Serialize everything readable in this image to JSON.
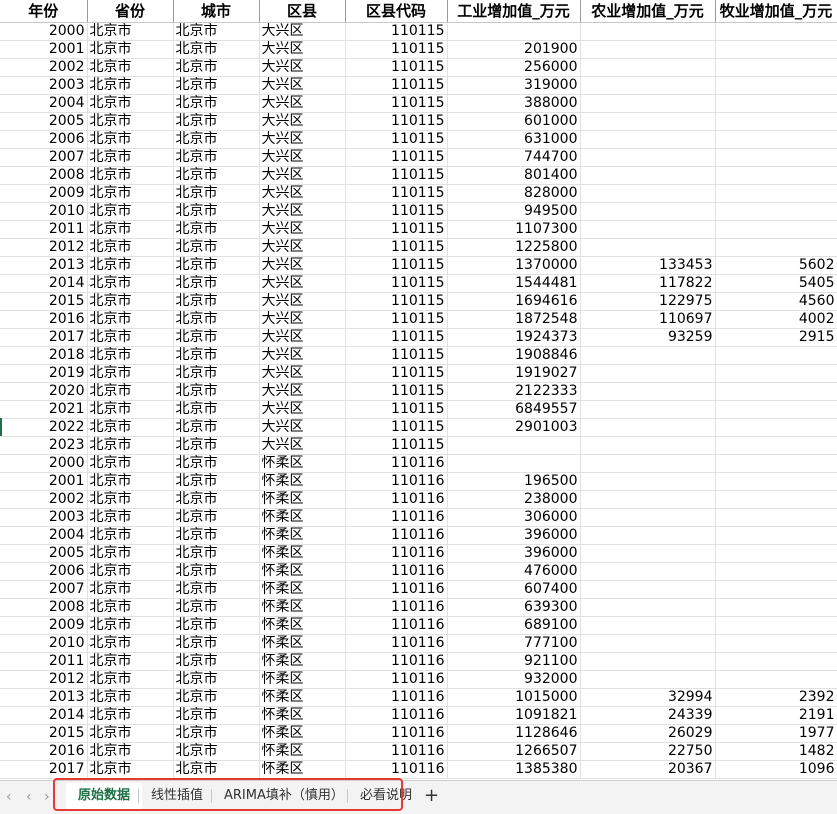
{
  "headers": [
    "年份",
    "省份",
    "城市",
    "区县",
    "区县代码",
    "工业增加值_万元",
    "农业增加值_万元",
    "牧业增加值_万元"
  ],
  "rows": [
    [
      "2000",
      "北京市",
      "北京市",
      "大兴区",
      "110115",
      "",
      "",
      ""
    ],
    [
      "2001",
      "北京市",
      "北京市",
      "大兴区",
      "110115",
      "201900",
      "",
      ""
    ],
    [
      "2002",
      "北京市",
      "北京市",
      "大兴区",
      "110115",
      "256000",
      "",
      ""
    ],
    [
      "2003",
      "北京市",
      "北京市",
      "大兴区",
      "110115",
      "319000",
      "",
      ""
    ],
    [
      "2004",
      "北京市",
      "北京市",
      "大兴区",
      "110115",
      "388000",
      "",
      ""
    ],
    [
      "2005",
      "北京市",
      "北京市",
      "大兴区",
      "110115",
      "601000",
      "",
      ""
    ],
    [
      "2006",
      "北京市",
      "北京市",
      "大兴区",
      "110115",
      "631000",
      "",
      ""
    ],
    [
      "2007",
      "北京市",
      "北京市",
      "大兴区",
      "110115",
      "744700",
      "",
      ""
    ],
    [
      "2008",
      "北京市",
      "北京市",
      "大兴区",
      "110115",
      "801400",
      "",
      ""
    ],
    [
      "2009",
      "北京市",
      "北京市",
      "大兴区",
      "110115",
      "828000",
      "",
      ""
    ],
    [
      "2010",
      "北京市",
      "北京市",
      "大兴区",
      "110115",
      "949500",
      "",
      ""
    ],
    [
      "2011",
      "北京市",
      "北京市",
      "大兴区",
      "110115",
      "1107300",
      "",
      ""
    ],
    [
      "2012",
      "北京市",
      "北京市",
      "大兴区",
      "110115",
      "1225800",
      "",
      ""
    ],
    [
      "2013",
      "北京市",
      "北京市",
      "大兴区",
      "110115",
      "1370000",
      "133453",
      "5602"
    ],
    [
      "2014",
      "北京市",
      "北京市",
      "大兴区",
      "110115",
      "1544481",
      "117822",
      "5405"
    ],
    [
      "2015",
      "北京市",
      "北京市",
      "大兴区",
      "110115",
      "1694616",
      "122975",
      "4560"
    ],
    [
      "2016",
      "北京市",
      "北京市",
      "大兴区",
      "110115",
      "1872548",
      "110697",
      "4002"
    ],
    [
      "2017",
      "北京市",
      "北京市",
      "大兴区",
      "110115",
      "1924373",
      "93259",
      "2915"
    ],
    [
      "2018",
      "北京市",
      "北京市",
      "大兴区",
      "110115",
      "1908846",
      "",
      ""
    ],
    [
      "2019",
      "北京市",
      "北京市",
      "大兴区",
      "110115",
      "1919027",
      "",
      ""
    ],
    [
      "2020",
      "北京市",
      "北京市",
      "大兴区",
      "110115",
      "2122333",
      "",
      ""
    ],
    [
      "2021",
      "北京市",
      "北京市",
      "大兴区",
      "110115",
      "6849557",
      "",
      ""
    ],
    [
      "2022",
      "北京市",
      "北京市",
      "大兴区",
      "110115",
      "2901003",
      "",
      ""
    ],
    [
      "2023",
      "北京市",
      "北京市",
      "大兴区",
      "110115",
      "",
      "",
      ""
    ],
    [
      "2000",
      "北京市",
      "北京市",
      "怀柔区",
      "110116",
      "",
      "",
      ""
    ],
    [
      "2001",
      "北京市",
      "北京市",
      "怀柔区",
      "110116",
      "196500",
      "",
      ""
    ],
    [
      "2002",
      "北京市",
      "北京市",
      "怀柔区",
      "110116",
      "238000",
      "",
      ""
    ],
    [
      "2003",
      "北京市",
      "北京市",
      "怀柔区",
      "110116",
      "306000",
      "",
      ""
    ],
    [
      "2004",
      "北京市",
      "北京市",
      "怀柔区",
      "110116",
      "396000",
      "",
      ""
    ],
    [
      "2005",
      "北京市",
      "北京市",
      "怀柔区",
      "110116",
      "396000",
      "",
      ""
    ],
    [
      "2006",
      "北京市",
      "北京市",
      "怀柔区",
      "110116",
      "476000",
      "",
      ""
    ],
    [
      "2007",
      "北京市",
      "北京市",
      "怀柔区",
      "110116",
      "607400",
      "",
      ""
    ],
    [
      "2008",
      "北京市",
      "北京市",
      "怀柔区",
      "110116",
      "639300",
      "",
      ""
    ],
    [
      "2009",
      "北京市",
      "北京市",
      "怀柔区",
      "110116",
      "689100",
      "",
      ""
    ],
    [
      "2010",
      "北京市",
      "北京市",
      "怀柔区",
      "110116",
      "777100",
      "",
      ""
    ],
    [
      "2011",
      "北京市",
      "北京市",
      "怀柔区",
      "110116",
      "921100",
      "",
      ""
    ],
    [
      "2012",
      "北京市",
      "北京市",
      "怀柔区",
      "110116",
      "932000",
      "",
      ""
    ],
    [
      "2013",
      "北京市",
      "北京市",
      "怀柔区",
      "110116",
      "1015000",
      "32994",
      "2392"
    ],
    [
      "2014",
      "北京市",
      "北京市",
      "怀柔区",
      "110116",
      "1091821",
      "24339",
      "2191"
    ],
    [
      "2015",
      "北京市",
      "北京市",
      "怀柔区",
      "110116",
      "1128646",
      "26029",
      "1977"
    ],
    [
      "2016",
      "北京市",
      "北京市",
      "怀柔区",
      "110116",
      "1266507",
      "22750",
      "1482"
    ],
    [
      "2017",
      "北京市",
      "北京市",
      "怀柔区",
      "110116",
      "1385380",
      "20367",
      "1096"
    ]
  ],
  "tabs": {
    "nav_prev_all": "‹",
    "nav_prev": "‹",
    "nav_next": "›",
    "tab1": "原始数据",
    "tab2": "线性插值",
    "tab3": "ARIMA填补（慎用）",
    "tab4": "必看说明",
    "add": "+"
  },
  "colors": {
    "active_tab": "#1e7145",
    "highlight_box": "#e53935"
  }
}
